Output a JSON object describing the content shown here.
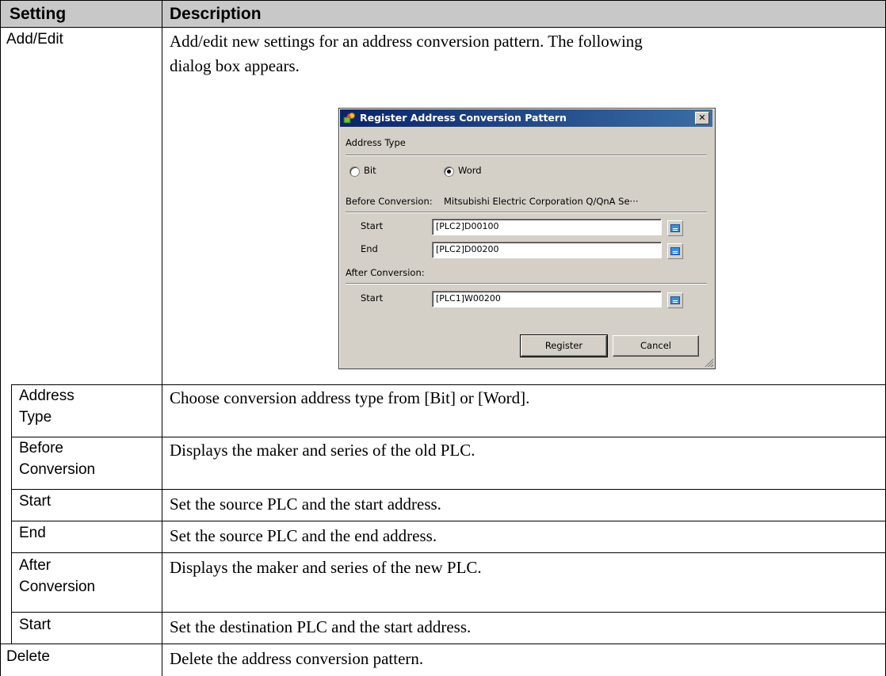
{
  "table": {
    "headers": {
      "setting": "Setting",
      "description": "Description"
    },
    "rows": {
      "add_edit": {
        "setting": "Add/Edit",
        "description_line1": "Add/edit new settings for an address conversion pattern. The following",
        "description_line2": "dialog box appears."
      },
      "address_type": {
        "setting_line1": "Address",
        "setting_line2": "Type",
        "description": "Choose conversion address type from [Bit] or [Word]."
      },
      "before_conversion": {
        "setting_line1": "Before",
        "setting_line2": "Conversion",
        "description": "Displays the maker and series of the old PLC."
      },
      "start_before": {
        "setting": "Start",
        "description": "Set the source PLC and the start address."
      },
      "end": {
        "setting": "End",
        "description": "Set the source PLC and the end address."
      },
      "after_conversion": {
        "setting_line1": "After",
        "setting_line2": "Conversion",
        "description": "Displays the maker and series of the new PLC."
      },
      "start_after": {
        "setting": "Start",
        "description": "Set the destination PLC and the start address."
      },
      "delete": {
        "setting": "Delete",
        "description": "Delete the address conversion pattern."
      }
    }
  },
  "dialog": {
    "title": "Register Address Conversion Pattern",
    "close_glyph": "✕",
    "address_type_label": "Address Type",
    "radio_bit": "Bit",
    "radio_word": "Word",
    "selected_type": "Word",
    "before_conversion_label": "Before Conversion:",
    "before_conversion_value": "Mitsubishi Electric Corporation Q/QnA Se···",
    "start_label": "Start",
    "end_label": "End",
    "before_start_value": "[PLC2]D00100",
    "before_end_value": "[PLC2]D00200",
    "after_conversion_label": "After Conversion:",
    "after_start_label": "Start",
    "after_start_value": "[PLC1]W00200",
    "register_button": "Register",
    "cancel_button": "Cancel",
    "icons": [
      "app-icon",
      "close-icon",
      "address-input-icon",
      "resize-grip-icon"
    ]
  }
}
